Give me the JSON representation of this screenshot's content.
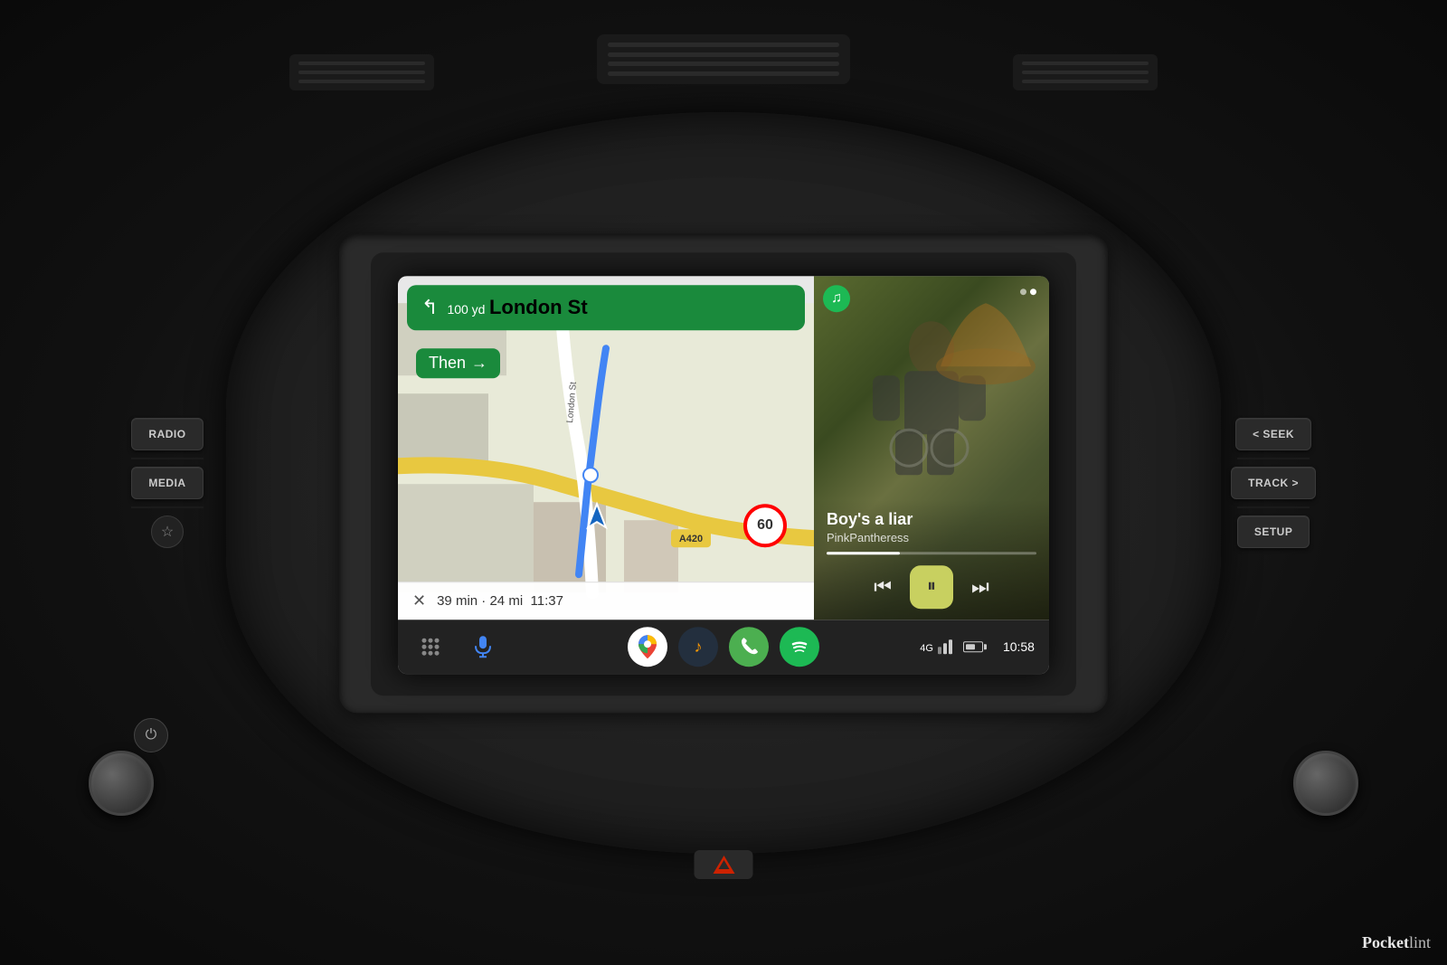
{
  "dashboard": {
    "background_color": "#1a1a1a"
  },
  "left_controls": {
    "radio_label": "RADIO",
    "media_label": "MEDIA",
    "star_icon": "☆",
    "power_icon": "⏻"
  },
  "right_controls": {
    "seek_label": "< SEEK",
    "track_label": "TRACK >",
    "setup_label": "SETUP"
  },
  "navigation": {
    "distance": "100 yd",
    "street": "London St",
    "instruction": "Then",
    "then_arrow": "→",
    "arrow": "↰",
    "eta_minutes": "39 min",
    "eta_distance": "24 mi",
    "eta_time": "11:37",
    "speed_limit": "60",
    "road_label": "A420",
    "street_label": "London St"
  },
  "music": {
    "title": "Boy's a liar",
    "artist": "PinkPantheress",
    "app": "spotify",
    "progress_percent": 35,
    "prev_icon": "⏮",
    "pause_icon": "⏸",
    "next_icon": "⏭"
  },
  "taskbar": {
    "grid_icon": "⊞",
    "mic_icon": "🎤",
    "maps_icon": "📍",
    "amazon_icon": "🎵",
    "phone_icon": "📞",
    "spotify_icon": "♫",
    "time": "10:58",
    "signal": "4G"
  },
  "watermark": {
    "text_pocket": "Pocket",
    "text_lint": "lint"
  }
}
